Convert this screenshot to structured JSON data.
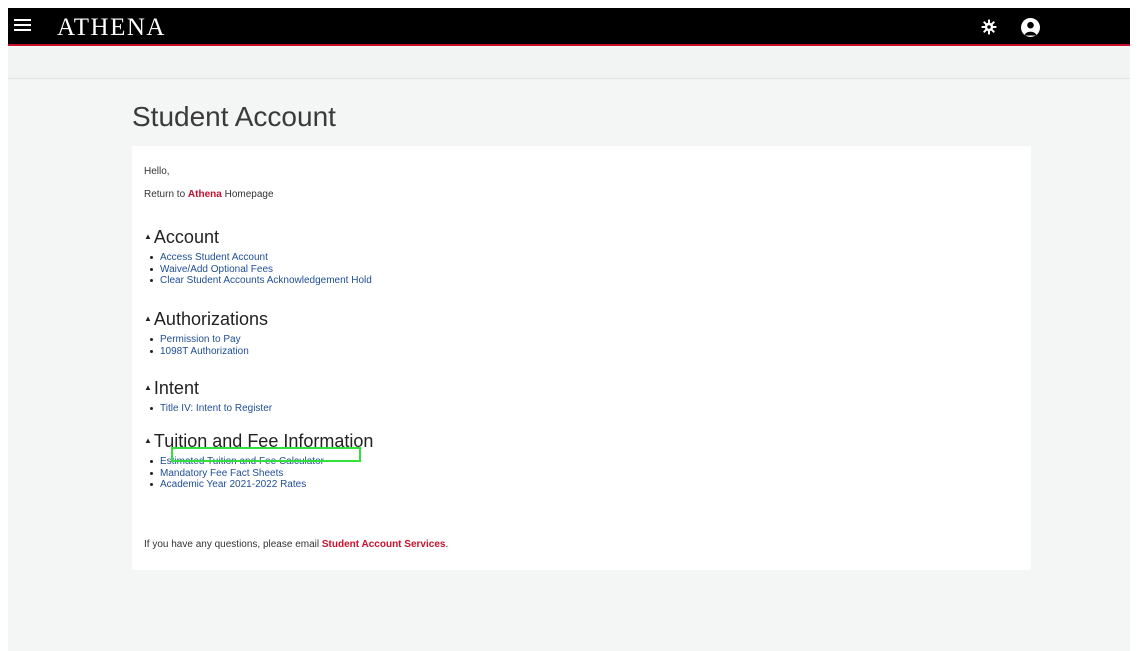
{
  "header": {
    "logo_text": "ATHENA",
    "menu_icon": "hamburger-menu-icon",
    "settings_icon": "gear-icon",
    "user_icon": "user-avatar-icon",
    "brand_color": "#c8102e"
  },
  "page": {
    "title": "Student Account"
  },
  "card": {
    "greeting": "Hello,",
    "return_prefix": "Return to ",
    "return_link": "Athena",
    "return_suffix": " Homepage",
    "sections": [
      {
        "heading": "Account",
        "links": [
          "Access Student Account",
          "Waive/Add Optional Fees",
          "Clear Student Accounts Acknowledgement Hold"
        ]
      },
      {
        "heading": "Authorizations",
        "links": [
          "Permission to Pay",
          "1098T Authorization"
        ]
      },
      {
        "heading": "Intent",
        "links": [
          "Title IV: Intent to Register"
        ]
      },
      {
        "heading": "Tuition and Fee Information",
        "links": [
          "Estimated Tuition and Fee Calculator",
          "Mandatory Fee Fact Sheets",
          "Academic Year 2021-2022 Rates"
        ]
      }
    ],
    "footer_prefix": "If you have any questions, please email ",
    "footer_link": "Student Account Services",
    "footer_suffix": ".",
    "highlight_color": "#31e03b"
  }
}
